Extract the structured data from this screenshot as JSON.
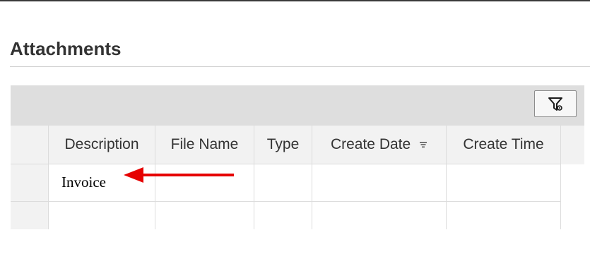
{
  "section": {
    "title": "Attachments"
  },
  "toolbar": {
    "filter_icon": "filter-settings-icon"
  },
  "table": {
    "columns": [
      "Description",
      "File Name",
      "Type",
      "Create Date",
      "Create Time"
    ],
    "sort_icon": "sort-descending-icon",
    "rows": [
      {
        "description": "Invoice",
        "file_name": "",
        "type": "",
        "create_date": "",
        "create_time": ""
      },
      {
        "description": "",
        "file_name": "",
        "type": "",
        "create_date": "",
        "create_time": ""
      }
    ]
  },
  "annotation": {
    "arrow_color": "#e60000",
    "icon": "red-arrow-left-icon"
  },
  "colors": {
    "toolbar_bg": "#dedede",
    "header_bg": "#f2f2f2",
    "grid_line": "#dcdcdc"
  }
}
